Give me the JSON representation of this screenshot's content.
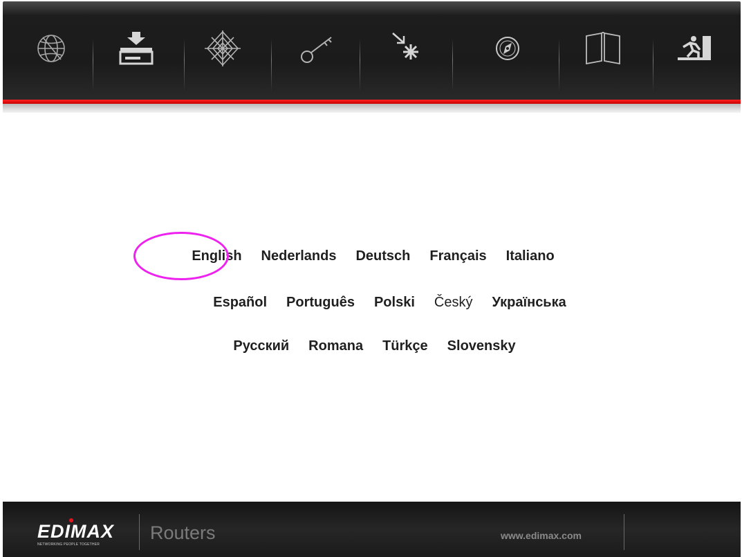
{
  "toolbar": {
    "icons": [
      {
        "name": "globe-icon"
      },
      {
        "name": "install-icon"
      },
      {
        "name": "network-web-icon"
      },
      {
        "name": "key-icon"
      },
      {
        "name": "spark-icon"
      },
      {
        "name": "compass-icon"
      },
      {
        "name": "manual-book-icon"
      },
      {
        "name": "exit-icon"
      }
    ]
  },
  "languages": {
    "row1": [
      "English",
      "Nederlands",
      "Deutsch",
      "Français",
      "Italiano"
    ],
    "row2": [
      "Español",
      "Português",
      "Polski",
      "Český",
      "Українська"
    ],
    "row3": [
      "Русский",
      "Romana",
      "Türkçe",
      "Slovensky"
    ]
  },
  "highlight": {
    "target": "English",
    "color": "#ee22ee"
  },
  "footer": {
    "brand": "EDIMAX",
    "tagline": "NETWORKING PEOPLE TOGETHER",
    "product": "Routers",
    "url": "www.edimax.com"
  },
  "colors": {
    "accent": "#e3141b",
    "toolbar_bg": "#1b1b1b"
  }
}
